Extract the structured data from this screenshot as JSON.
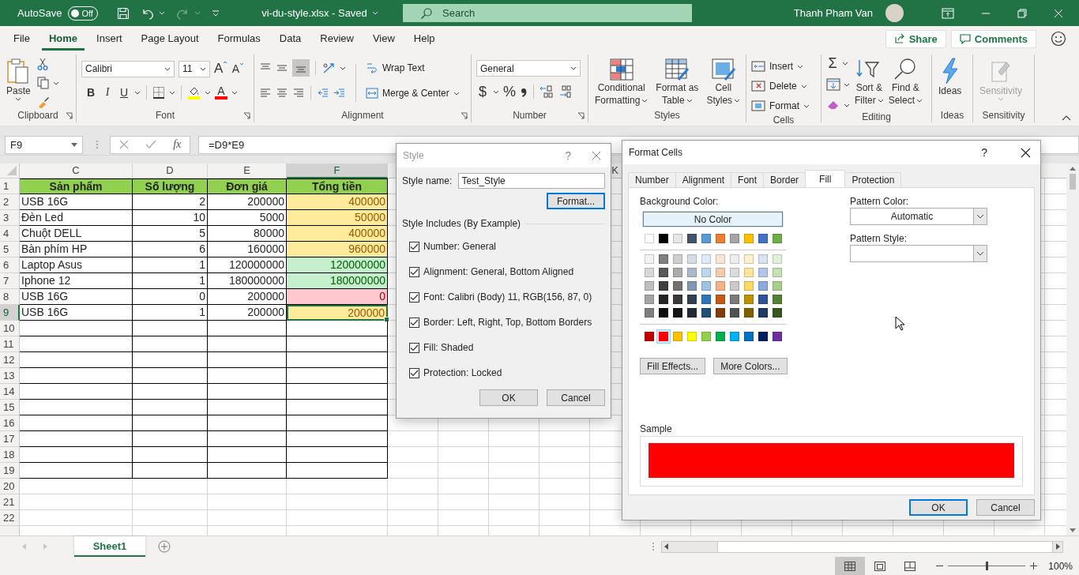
{
  "title_bar": {
    "autosave_label": "AutoSave",
    "autosave_on": false,
    "autosave_state": "Off",
    "document_title": "vi-du-style.xlsx - Saved",
    "search_placeholder": "Search",
    "user_name": "Thanh Pham Van"
  },
  "menu_tabs": [
    {
      "label": "File",
      "selected": false
    },
    {
      "label": "Home",
      "selected": true
    },
    {
      "label": "Insert",
      "selected": false
    },
    {
      "label": "Page Layout",
      "selected": false
    },
    {
      "label": "Formulas",
      "selected": false
    },
    {
      "label": "Data",
      "selected": false
    },
    {
      "label": "Review",
      "selected": false
    },
    {
      "label": "View",
      "selected": false
    },
    {
      "label": "Help",
      "selected": false
    }
  ],
  "share_button": "Share",
  "comments_button": "Comments",
  "ribbon": {
    "clipboard": {
      "paste": "Paste",
      "label": "Clipboard"
    },
    "font": {
      "font_name": "Calibri",
      "font_size": "11",
      "grow_font": "A",
      "shrink_font": "A",
      "bold": "B",
      "italic": "I",
      "underline": "U",
      "font_color": "A",
      "label": "Font"
    },
    "alignment": {
      "wrap_text": "Wrap Text",
      "merge_center": "Merge & Center",
      "label": "Alignment"
    },
    "number": {
      "format": "General",
      "currency": "$",
      "percent": "%",
      "label": "Number"
    },
    "styles": {
      "conditional": [
        "Conditional",
        "Formatting"
      ],
      "format_table": [
        "Format as",
        "Table"
      ],
      "cell_styles": [
        "Cell",
        "Styles"
      ],
      "label": "Styles"
    },
    "cells": {
      "insert": "Insert",
      "delete": "Delete",
      "format": "Format",
      "label": "Cells"
    },
    "editing": {
      "autosum": "Σ",
      "sort_filter": [
        "Sort &",
        "Filter"
      ],
      "find_select": [
        "Find &",
        "Select"
      ],
      "label": "Editing"
    },
    "ideas": {
      "button": "Ideas",
      "label": "Ideas"
    },
    "sensitivity": {
      "button": "Sensitivity",
      "disabled": true,
      "label": "Sensitivity"
    }
  },
  "formula_bar": {
    "name_box": "F9",
    "function_symbol": "fx",
    "formula": "=D9*E9"
  },
  "sheet": {
    "column_headers": [
      {
        "label": "C",
        "selected": false
      },
      {
        "label": "D",
        "selected": false
      },
      {
        "label": "E",
        "selected": false
      },
      {
        "label": "F",
        "selected": true
      }
    ],
    "far_column_header": "K",
    "rows": [
      {
        "number": "1",
        "selected": false,
        "kind": "header",
        "cells": [
          "Sản phẩm",
          "Số lượng",
          "Đơn giá",
          "Tổng tiền"
        ]
      },
      {
        "number": "2",
        "selected": false,
        "kind": "data",
        "cells": [
          "USB 16G",
          "2",
          "200000",
          "400000"
        ],
        "color": "#ffeb9c"
      },
      {
        "number": "3",
        "selected": false,
        "kind": "data",
        "cells": [
          "Đèn Led",
          "10",
          "5000",
          "50000"
        ],
        "color": "#ffeb9c"
      },
      {
        "number": "4",
        "selected": false,
        "kind": "data",
        "cells": [
          "Chuột DELL",
          "5",
          "80000",
          "400000"
        ],
        "color": "#ffeb9c"
      },
      {
        "number": "5",
        "selected": false,
        "kind": "data",
        "cells": [
          "Bàn phím HP",
          "6",
          "160000",
          "960000"
        ],
        "color": "#ffeb9c"
      },
      {
        "number": "6",
        "selected": false,
        "kind": "data",
        "cells": [
          "Laptop Asus",
          "1",
          "120000000",
          "120000000"
        ],
        "color": "#c6efce"
      },
      {
        "number": "7",
        "selected": false,
        "kind": "data",
        "cells": [
          "Iphone 12",
          "1",
          "180000000",
          "180000000"
        ],
        "color": "#c6efce"
      },
      {
        "number": "8",
        "selected": false,
        "kind": "data",
        "cells": [
          "USB 16G",
          "0",
          "200000",
          "0"
        ],
        "color": "#ffc7ce"
      },
      {
        "number": "9",
        "selected": true,
        "kind": "data",
        "cells": [
          "USB 16G",
          "1",
          "200000",
          "200000"
        ],
        "color": "#ffeb9c"
      },
      {
        "number": "10",
        "selected": false,
        "kind": "empty",
        "bordered": true
      },
      {
        "number": "11",
        "selected": false,
        "kind": "empty",
        "bordered": true
      },
      {
        "number": "12",
        "selected": false,
        "kind": "empty",
        "bordered": true
      },
      {
        "number": "13",
        "selected": false,
        "kind": "empty",
        "bordered": true
      },
      {
        "number": "14",
        "selected": false,
        "kind": "empty",
        "bordered": true
      },
      {
        "number": "15",
        "selected": false,
        "kind": "empty",
        "bordered": true
      },
      {
        "number": "16",
        "selected": false,
        "kind": "empty",
        "bordered": true
      },
      {
        "number": "17",
        "selected": false,
        "kind": "empty",
        "bordered": true
      },
      {
        "number": "18",
        "selected": false,
        "kind": "empty",
        "bordered": true
      },
      {
        "number": "19",
        "selected": false,
        "kind": "empty",
        "bordered": true
      },
      {
        "number": "20",
        "selected": false,
        "kind": "empty",
        "bordered": false
      },
      {
        "number": "21",
        "selected": false,
        "kind": "empty",
        "bordered": false
      },
      {
        "number": "22",
        "selected": false,
        "kind": "empty",
        "bordered": false
      }
    ]
  },
  "sheet_tabs": [
    {
      "label": "Sheet1",
      "selected": true
    }
  ],
  "status_bar": {
    "views": [
      {
        "selected": true
      },
      {
        "selected": false
      },
      {
        "selected": false
      }
    ],
    "zoom": {
      "level": 0.5,
      "reading": "100%"
    }
  },
  "style_dialog": {
    "title": "Style",
    "help": "?",
    "style_name_label": "Style name:",
    "style_name": "Test_Style",
    "format_button": "Format...",
    "includes_label": "Style Includes (By Example)",
    "options": [
      {
        "label": "Number: General",
        "checked": true
      },
      {
        "label": "Alignment: General, Bottom Aligned",
        "checked": true
      },
      {
        "label": "Font: Calibri (Body) 11, RGB(156, 87, 0)",
        "checked": true
      },
      {
        "label": "Border: Left, Right, Top, Bottom Borders",
        "checked": true
      },
      {
        "label": "Fill: Shaded",
        "checked": true
      },
      {
        "label": "Protection: Locked",
        "checked": true
      }
    ],
    "ok": "OK",
    "cancel": "Cancel"
  },
  "format_cells": {
    "title": "Format Cells",
    "help": "?",
    "tabs": [
      {
        "label": "Number",
        "selected": false
      },
      {
        "label": "Alignment",
        "selected": false
      },
      {
        "label": "Font",
        "selected": false
      },
      {
        "label": "Border",
        "selected": false
      },
      {
        "label": "Fill",
        "selected": true
      },
      {
        "label": "Protection",
        "selected": false
      }
    ],
    "background_color_label": "Background Color:",
    "no_color": "No Color",
    "theme_colors": [
      {
        "color": "#ffffff",
        "selected": false
      },
      {
        "color": "#000000",
        "selected": false
      },
      {
        "color": "#e7e6e6",
        "selected": false
      },
      {
        "color": "#44546a",
        "selected": false
      },
      {
        "color": "#5b9bd5",
        "selected": false
      },
      {
        "color": "#ed7d31",
        "selected": false
      },
      {
        "color": "#a5a5a5",
        "selected": false
      },
      {
        "color": "#ffc000",
        "selected": false
      },
      {
        "color": "#4472c4",
        "selected": false
      },
      {
        "color": "#70ad47",
        "selected": false
      }
    ],
    "shade_rows": [
      {
        "swatches": [
          {
            "color": "#f2f2f2",
            "selected": false
          },
          {
            "color": "#7f7f7f",
            "selected": false
          },
          {
            "color": "#d0cece",
            "selected": false
          },
          {
            "color": "#d6dce4",
            "selected": false
          },
          {
            "color": "#deebf6",
            "selected": false
          },
          {
            "color": "#fbe5d5",
            "selected": false
          },
          {
            "color": "#ededed",
            "selected": false
          },
          {
            "color": "#fff2cc",
            "selected": false
          },
          {
            "color": "#d9e2f3",
            "selected": false
          },
          {
            "color": "#e2efd9",
            "selected": false
          }
        ]
      },
      {
        "swatches": [
          {
            "color": "#d8d8d8",
            "selected": false
          },
          {
            "color": "#595959",
            "selected": false
          },
          {
            "color": "#aeabab",
            "selected": false
          },
          {
            "color": "#adb9ca",
            "selected": false
          },
          {
            "color": "#bdd7ee",
            "selected": false
          },
          {
            "color": "#f7cbac",
            "selected": false
          },
          {
            "color": "#dbdbdb",
            "selected": false
          },
          {
            "color": "#fee599",
            "selected": false
          },
          {
            "color": "#b4c6e7",
            "selected": false
          },
          {
            "color": "#c5e0b3",
            "selected": false
          }
        ]
      },
      {
        "swatches": [
          {
            "color": "#bfbfbf",
            "selected": false
          },
          {
            "color": "#3f3f3f",
            "selected": false
          },
          {
            "color": "#757070",
            "selected": false
          },
          {
            "color": "#8496b0",
            "selected": false
          },
          {
            "color": "#9cc3e5",
            "selected": false
          },
          {
            "color": "#f4b183",
            "selected": false
          },
          {
            "color": "#c9c9c9",
            "selected": false
          },
          {
            "color": "#ffd965",
            "selected": false
          },
          {
            "color": "#8eaadb",
            "selected": false
          },
          {
            "color": "#a8d08d",
            "selected": false
          }
        ]
      },
      {
        "swatches": [
          {
            "color": "#a5a5a5",
            "selected": false
          },
          {
            "color": "#262626",
            "selected": false
          },
          {
            "color": "#3a3838",
            "selected": false
          },
          {
            "color": "#323f4f",
            "selected": false
          },
          {
            "color": "#2e75b5",
            "selected": false
          },
          {
            "color": "#c55a11",
            "selected": false
          },
          {
            "color": "#7b7b7b",
            "selected": false
          },
          {
            "color": "#bf9000",
            "selected": false
          },
          {
            "color": "#2f5496",
            "selected": false
          },
          {
            "color": "#538135",
            "selected": false
          }
        ]
      },
      {
        "swatches": [
          {
            "color": "#7f7f7f",
            "selected": false
          },
          {
            "color": "#0c0c0c",
            "selected": false
          },
          {
            "color": "#171616",
            "selected": false
          },
          {
            "color": "#222a35",
            "selected": false
          },
          {
            "color": "#1e4e79",
            "selected": false
          },
          {
            "color": "#843c0b",
            "selected": false
          },
          {
            "color": "#525252",
            "selected": false
          },
          {
            "color": "#7f6000",
            "selected": false
          },
          {
            "color": "#1f3864",
            "selected": false
          },
          {
            "color": "#375623",
            "selected": false
          }
        ]
      }
    ],
    "standard_colors": [
      {
        "color": "#c00000",
        "selected": false
      },
      {
        "color": "#ff0000",
        "selected": true
      },
      {
        "color": "#ffc000",
        "selected": false
      },
      {
        "color": "#ffff00",
        "selected": false
      },
      {
        "color": "#92d050",
        "selected": false
      },
      {
        "color": "#00b050",
        "selected": false
      },
      {
        "color": "#00b0f0",
        "selected": false
      },
      {
        "color": "#0070c0",
        "selected": false
      },
      {
        "color": "#002060",
        "selected": false
      },
      {
        "color": "#7030a0",
        "selected": false
      }
    ],
    "fill_effects": "Fill Effects...",
    "more_colors": "More Colors...",
    "pattern_color_label": "Pattern Color:",
    "pattern_color": "Automatic",
    "pattern_style_label": "Pattern Style:",
    "sample": {
      "label": "Sample",
      "color": "#ff0000"
    },
    "ok": "OK",
    "cancel": "Cancel"
  }
}
